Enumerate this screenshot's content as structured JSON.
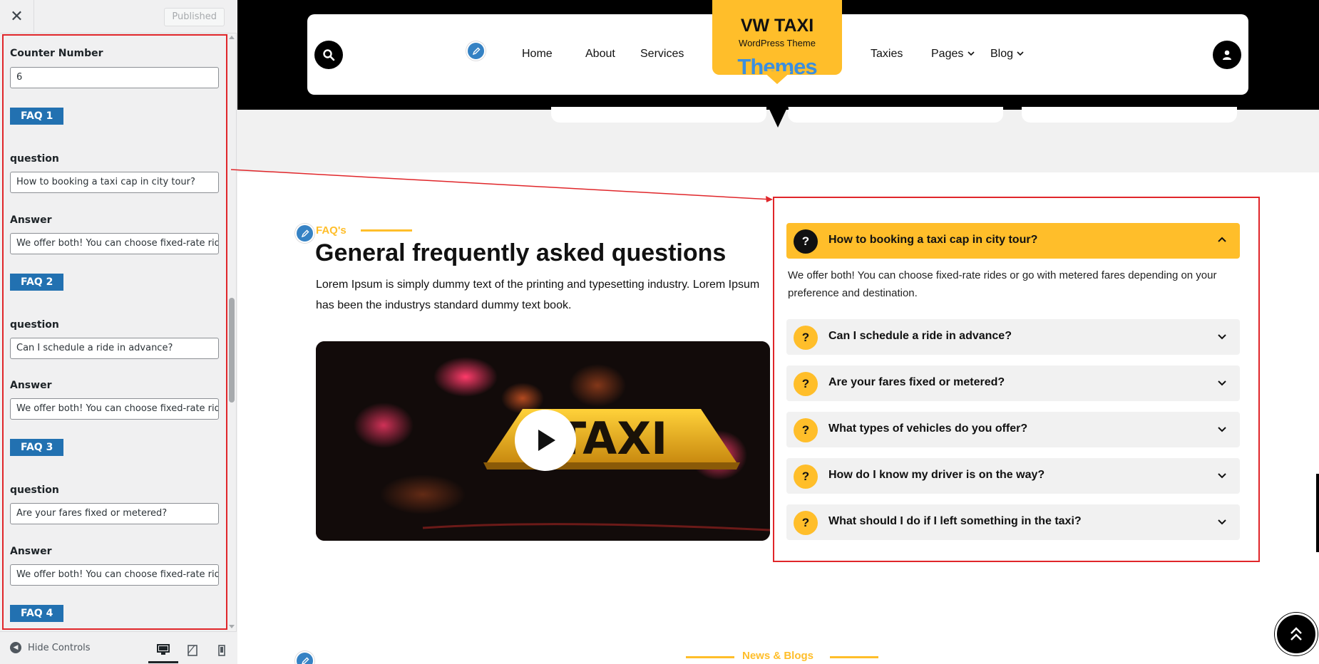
{
  "customizer": {
    "close_icon": "close-icon",
    "publish_label": "Published",
    "fields": {
      "counter_label": "Counter Number",
      "counter_value": "6",
      "question_label": "question",
      "answer_label": "Answer"
    },
    "faqs": [
      {
        "badge": "FAQ 1",
        "question": "How to booking a taxi cap in city tour?",
        "answer": "We offer both! You can choose fixed-rate rides or go with metered fares depending on your preference and destination."
      },
      {
        "badge": "FAQ 2",
        "question": "Can I schedule a ride in advance?",
        "answer": "We offer both! You can choose fixed-rate rides or go with metered fares depending on your preference and destination."
      },
      {
        "badge": "FAQ 3",
        "question": "Are your fares fixed or metered?",
        "answer": "We offer both! You can choose fixed-rate rides or go with metered fares depending on your preference and destination."
      },
      {
        "badge": "FAQ 4"
      }
    ],
    "footer": {
      "hide_controls": "Hide Controls",
      "devices": [
        "desktop-icon",
        "tablet-icon",
        "mobile-icon"
      ]
    }
  },
  "site": {
    "logo": {
      "title": "VW TAXI",
      "subtitle": "WordPress Theme",
      "themes": "Themes"
    },
    "nav": [
      {
        "label": "Home"
      },
      {
        "label": "About"
      },
      {
        "label": "Services"
      },
      {
        "label": "Taxies"
      },
      {
        "label": "Pages"
      },
      {
        "label": "Blog"
      }
    ],
    "faq_section": {
      "eyebrow": "FAQ's",
      "heading": "General frequently asked questions",
      "description": "Lorem Ipsum is simply dummy text of the printing and typesetting industry. Lorem Ipsum has been the industrys standard dummy text book.",
      "video_sign": "TAXI",
      "items": [
        {
          "question": "How to booking a taxi cap in city tour?",
          "answer": "We offer both! You can choose fixed-rate rides or go with metered fares depending on your preference and destination.",
          "open": true
        },
        {
          "question": "Can I schedule a ride in advance?"
        },
        {
          "question": "Are your fares fixed or metered?"
        },
        {
          "question": "What types of vehicles do you offer?"
        },
        {
          "question": "How do I know my driver is on the way?"
        },
        {
          "question": "What should I do if I left something in the taxi?"
        }
      ]
    },
    "news_title": "News & Blogs"
  },
  "colors": {
    "accent": "#ffbe2a",
    "highlight": "#e0262a",
    "wp_blue": "#2271b1",
    "edit_blue": "#3582c4"
  }
}
